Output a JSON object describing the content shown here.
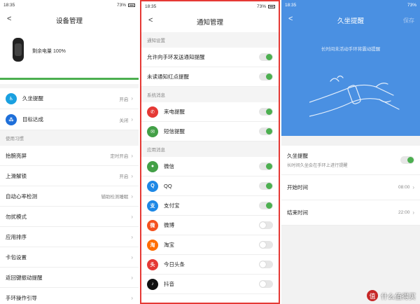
{
  "status": {
    "carrier": "⊞",
    "time": "18:35",
    "battery": "73%"
  },
  "panel1": {
    "title": "设备管理",
    "battery_text": "剩余电量 100%",
    "battery_fraction": 1.0,
    "rows_top": [
      {
        "label": "久坐提醒",
        "value": "开启",
        "icon": "sitting-icon",
        "color": "#1aa0e0"
      },
      {
        "label": "目标达成",
        "value": "关闭",
        "icon": "footsteps-icon",
        "color": "#1e6fd9"
      }
    ],
    "section": "使用习惯",
    "rows": [
      {
        "label": "抬腕亮屏",
        "value": "定时开启"
      },
      {
        "label": "上滑解锁",
        "value": "开启"
      },
      {
        "label": "自动心率检测",
        "value": "辅助检测睡眠"
      },
      {
        "label": "勿扰模式",
        "value": ""
      },
      {
        "label": "应用排序",
        "value": ""
      },
      {
        "label": "卡包设置",
        "value": ""
      },
      {
        "label": "返回键振动提醒",
        "value": ""
      },
      {
        "label": "手环操作引导",
        "value": ""
      }
    ]
  },
  "panel2": {
    "title": "通知管理",
    "section1": "通知设置",
    "settings": [
      {
        "label": "允许向手环发送通知提醒",
        "on": true
      },
      {
        "label": "未读通知红点提醒",
        "on": true
      }
    ],
    "section2": "系统消息",
    "system": [
      {
        "label": "来电提醒",
        "on": true,
        "icon": "phone-icon",
        "color": "#e53935",
        "glyph": "✆"
      },
      {
        "label": "短信提醒",
        "on": true,
        "icon": "sms-icon",
        "color": "#43a047",
        "glyph": "✉"
      }
    ],
    "section3": "应用消息",
    "apps": [
      {
        "label": "微信",
        "on": true,
        "icon": "wechat-icon",
        "color": "#43a047",
        "glyph": "●"
      },
      {
        "label": "QQ",
        "on": true,
        "icon": "qq-icon",
        "color": "#1e88e5",
        "glyph": "Q"
      },
      {
        "label": "支付宝",
        "on": true,
        "icon": "alipay-icon",
        "color": "#1e88e5",
        "glyph": "支"
      },
      {
        "label": "微博",
        "on": false,
        "icon": "weibo-icon",
        "color": "#f4511e",
        "glyph": "微"
      },
      {
        "label": "淘宝",
        "on": false,
        "icon": "taobao-icon",
        "color": "#ff6d00",
        "glyph": "淘"
      },
      {
        "label": "今日头条",
        "on": false,
        "icon": "toutiao-icon",
        "color": "#e53935",
        "glyph": "头"
      },
      {
        "label": "抖音",
        "on": false,
        "icon": "douyin-icon",
        "color": "#111111",
        "glyph": "♪"
      }
    ]
  },
  "panel3": {
    "title": "久坐提醒",
    "save_label": "保存",
    "hero_text": "长时间未活动手环将震动提醒",
    "main_label": "久坐提醒",
    "main_sub": "长时间久坐会在手环上进行提醒",
    "main_on": true,
    "start_label": "开始时间",
    "start_value": "08:00",
    "end_label": "结束时间",
    "end_value": "22:00"
  },
  "watermark": {
    "text": "什么值得买",
    "logo": "值"
  },
  "colors": {
    "accent_green": "#4caf50",
    "hero_blue": "#4a90e2",
    "highlight_red": "#e53935"
  }
}
